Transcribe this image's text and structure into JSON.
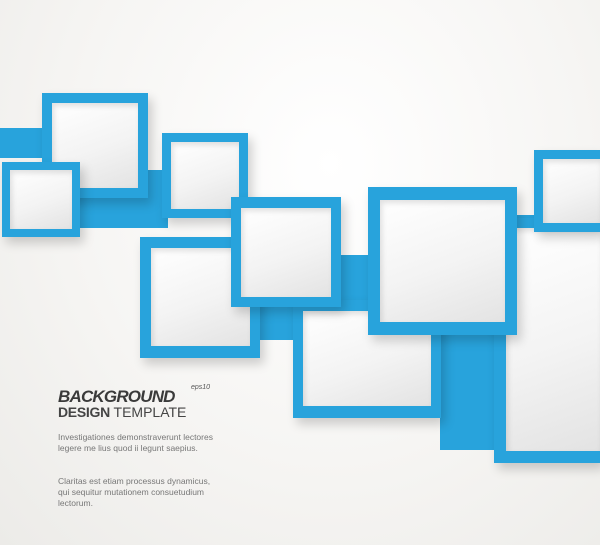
{
  "heading": {
    "background": "BACKGROUND",
    "eps_label": "eps10",
    "design": "DESIGN",
    "template": " TEMPLATE"
  },
  "paragraphs": [
    "Investigationes demonstraverunt lectores legere me lius quod ii legunt saepius.",
    "Claritas est etiam processus dynamicus, qui sequitur mutationem consuetudium lectorum."
  ],
  "colors": {
    "accent": "#28a3dc",
    "text": "#3a3a3a"
  }
}
